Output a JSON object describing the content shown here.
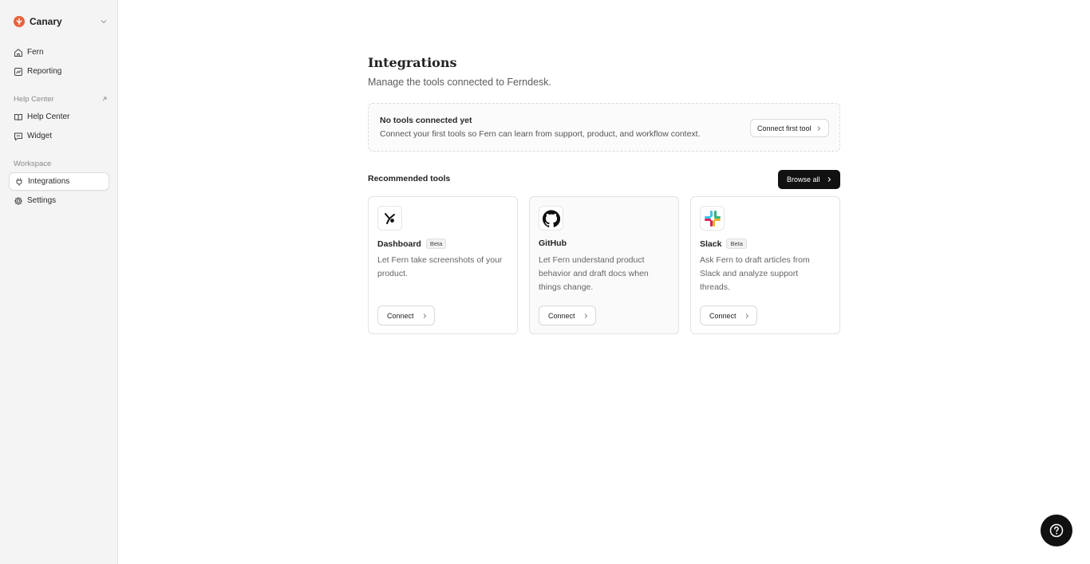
{
  "sidebar": {
    "workspace": {
      "name": "Canary"
    },
    "top_items": [
      {
        "label": "Fern",
        "icon": "home-icon"
      },
      {
        "label": "Reporting",
        "icon": "chart-icon"
      }
    ],
    "help_center_section": {
      "label": "Help Center",
      "items": [
        {
          "label": "Help Center",
          "icon": "book-icon"
        },
        {
          "label": "Widget",
          "icon": "message-icon"
        }
      ]
    },
    "workspace_section": {
      "label": "Workspace",
      "items": [
        {
          "label": "Integrations",
          "icon": "plug-icon",
          "active": true
        },
        {
          "label": "Settings",
          "icon": "gear-icon"
        }
      ]
    }
  },
  "header": {
    "title": "Integrations",
    "subtitle": "Manage the tools connected to Ferndesk."
  },
  "empty_state": {
    "title": "No tools connected yet",
    "description": "Connect your first tools so Fern can learn from support, product, and workflow context.",
    "button_label": "Connect first tool"
  },
  "recommended": {
    "title": "Recommended tools",
    "browse_label": "Browse all",
    "cards": [
      {
        "name": "Dashboard",
        "badge": "Beta",
        "description": "Let Fern take screenshots of your product.",
        "button_label": "Connect",
        "icon": "dashboard-icon"
      },
      {
        "name": "GitHub",
        "badge": "",
        "description": "Let Fern understand product behavior and draft docs when things change.",
        "button_label": "Connect",
        "icon": "github-icon"
      },
      {
        "name": "Slack",
        "badge": "Beta",
        "description": "Ask Fern to draft articles from Slack and analyze support threads.",
        "button_label": "Connect",
        "icon": "slack-icon"
      }
    ]
  },
  "colors": {
    "accent": "#e8623c",
    "primary_button": "#111111",
    "sidebar_bg": "#f4f4f4"
  }
}
